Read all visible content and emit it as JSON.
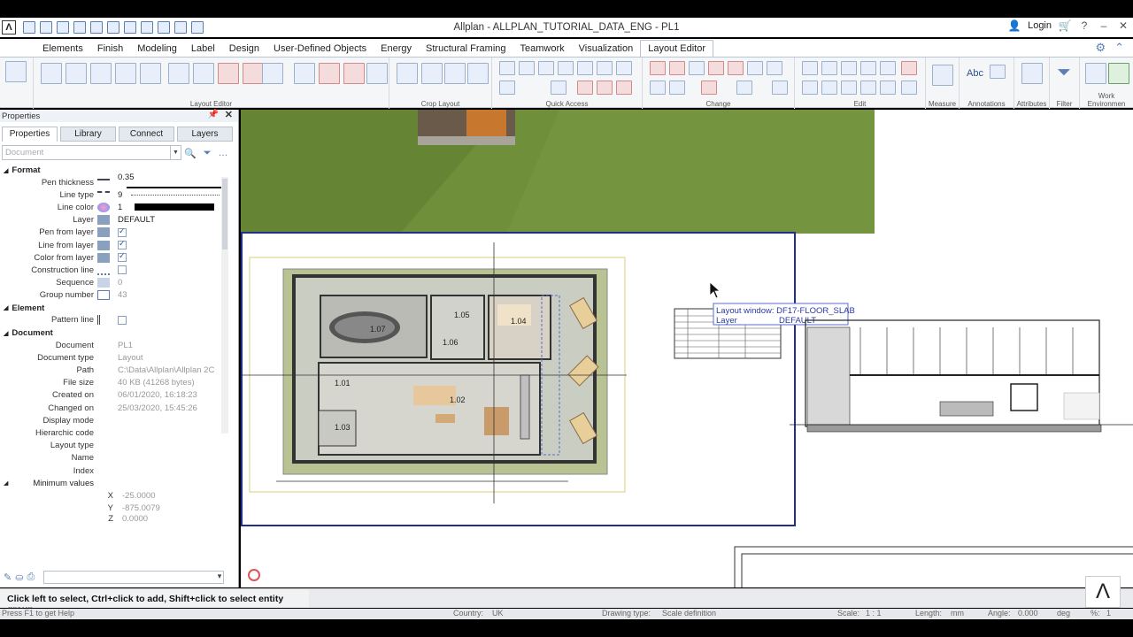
{
  "window": {
    "title": "Allplan - ALLPLAN_TUTORIAL_DATA_ENG - PL1",
    "login_label": "Login"
  },
  "ribbon_tabs": [
    "Elements",
    "Finish",
    "Modeling",
    "Label",
    "Design",
    "User-Defined Objects",
    "Energy",
    "Structural Framing",
    "Teamwork",
    "Visualization",
    "Layout Editor"
  ],
  "active_tab": "Layout Editor",
  "ribbon_groups": [
    "Layout Editor",
    "Crop Layout",
    "Quick Access",
    "Change",
    "Edit",
    "Measure",
    "Annotations",
    "Attributes",
    "Filter",
    "Work Environmen"
  ],
  "ribbon_small_text": {
    "abc": "Abc",
    "a_glyph": "A"
  },
  "panel": {
    "title": "Properties",
    "tabs": [
      "Properties",
      "Library",
      "Connect",
      "Layers"
    ],
    "active_tab": "Properties",
    "selector_placeholder": "Document",
    "sections": {
      "format": "Format",
      "element": "Element",
      "document": "Document"
    },
    "format_rows": [
      {
        "label": "Pen thickness",
        "value": "0.35"
      },
      {
        "label": "Line type",
        "value": "9"
      },
      {
        "label": "Line color",
        "value": "1"
      },
      {
        "label": "Layer",
        "value": "DEFAULT"
      },
      {
        "label": "Pen from layer",
        "checked": true
      },
      {
        "label": "Line from layer",
        "checked": true
      },
      {
        "label": "Color from layer",
        "checked": true
      },
      {
        "label": "Construction line",
        "checked": false
      },
      {
        "label": "Sequence",
        "value": "0"
      },
      {
        "label": "Group number",
        "value": "43"
      }
    ],
    "element_rows": [
      {
        "label": "Pattern line",
        "checked": false
      }
    ],
    "document_rows": [
      {
        "label": "Document",
        "value": "PL1"
      },
      {
        "label": "Document type",
        "value": "Layout"
      },
      {
        "label": "Path",
        "value": "C:\\Data\\Allplan\\Allplan 2C"
      },
      {
        "label": "File size",
        "value": "40 KB (41268 bytes)"
      },
      {
        "label": "Created on",
        "value": "06/01/2020, 16:18:23"
      },
      {
        "label": "Changed on",
        "value": "25/03/2020, 15:45:26"
      },
      {
        "label": "Display mode",
        "value": ""
      },
      {
        "label": "Hierarchic code",
        "value": ""
      },
      {
        "label": "Layout type",
        "value": ""
      },
      {
        "label": "Name",
        "value": ""
      },
      {
        "label": "Index",
        "value": ""
      }
    ],
    "minimum_values_label": "Minimum values",
    "minimum_values": [
      {
        "label": "X",
        "value": "-25.0000"
      },
      {
        "label": "Y",
        "value": "-875.0079"
      },
      {
        "label": "Z",
        "value": "0.0000"
      }
    ]
  },
  "canvas": {
    "tooltip_line1": "Layout window: DF17-FLOOR_SLAB",
    "tooltip_line2_label": "Layer",
    "tooltip_line2_value": "DEFAULT",
    "room_labels": [
      "1.07",
      "1.05",
      "1.04",
      "1.06",
      "1.01",
      "1.02",
      "1.03"
    ]
  },
  "status": {
    "hint": "Click left to select, Ctrl+click to add, Shift+click to select entity group",
    "bottom_items": [
      "Press F1 to get Help",
      "Country:",
      "UK",
      "Drawing type:",
      "Scale definition",
      "Scale:",
      "1 : 1",
      "Length:",
      "mm",
      "Angle:",
      "0.000",
      "deg",
      "%:",
      "1"
    ]
  },
  "colors": {
    "accent": "#5a7fb5",
    "grass": "#6f8f3a",
    "frame_blue": "#1f2f8a"
  }
}
